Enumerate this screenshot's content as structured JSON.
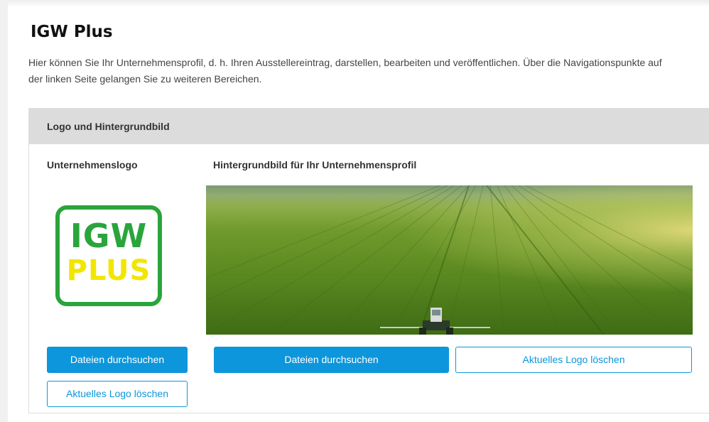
{
  "page": {
    "title": "IGW Plus",
    "intro": "Hier können Sie Ihr Unternehmensprofil, d. h. Ihren Ausstellereintrag, darstellen, bearbeiten und veröffentlichen. Über die Navigationspunkte auf der linken Seite gelangen Sie zu weiteren Bereichen."
  },
  "panel": {
    "header": "Logo und Hintergrundbild",
    "logo_column": {
      "label": "Unternehmenslogo",
      "logo_text_top": "IGW",
      "logo_text_bottom": "PLUS",
      "browse_label": "Dateien durchsuchen",
      "delete_label": "Aktuelles Logo löschen"
    },
    "background_column": {
      "label": "Hintergrundbild für Ihr Unternehmensprofil",
      "browse_label": "Dateien durchsuchen",
      "delete_label": "Aktuelles Logo löschen"
    }
  },
  "colors": {
    "primary_button": "#0d96db",
    "logo_green": "#2aa53c",
    "logo_yellow": "#f2e600",
    "panel_header_bg": "#dcdcdc"
  },
  "icons": [
    "igw-plus-logo",
    "field-background-image"
  ]
}
